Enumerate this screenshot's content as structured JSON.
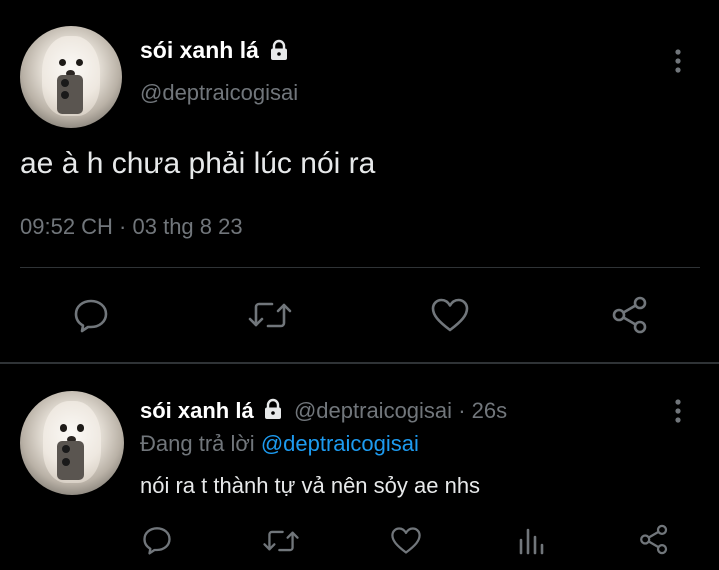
{
  "main_tweet": {
    "display_name": "sói xanh lá",
    "handle": "@deptraicogisai",
    "text": "ae à h chưa phải lúc nói ra",
    "timestamp": "09:52 CH · 03 thg 8 23",
    "actions": [
      "reply-icon",
      "retweet-icon",
      "like-icon",
      "share-icon"
    ]
  },
  "reply_tweet": {
    "display_name": "sói xanh lá",
    "handle": "@deptraicogisai",
    "separator": "·",
    "time_ago": "26s",
    "replying_prefix": "Đang trả lời",
    "replying_to": "@deptraicogisai",
    "text": "nói ra t thành tự vả nên sỏy ae nhs",
    "actions": [
      "reply-icon",
      "retweet-icon",
      "like-icon",
      "analytics-icon",
      "share-icon"
    ]
  },
  "colors": {
    "background": "#000000",
    "text": "#e7e9ea",
    "muted": "#71767b",
    "link": "#1d9bf0",
    "divider": "#2f3336"
  }
}
